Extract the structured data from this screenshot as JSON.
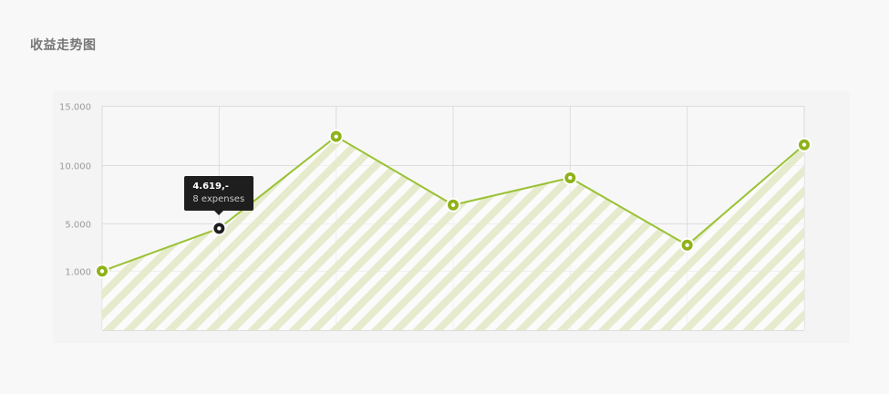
{
  "page": {
    "title": "收益走势图"
  },
  "colors": {
    "line": "#9ac234",
    "point": "#8fb21a",
    "point_active": "#1e1e1e",
    "grid": "#dddddd",
    "hatch": "#e8ecd3"
  },
  "tooltip": {
    "value_label": "4.619,-",
    "sub_label": "8 expenses",
    "point_index": 1
  },
  "chart_data": {
    "type": "area",
    "x": [
      0,
      1,
      2,
      3,
      4,
      5,
      6
    ],
    "y_ticks": [
      1000,
      5000,
      10000,
      15000
    ],
    "y_tick_labels": [
      "1.000",
      "5.000",
      "10.000",
      "15.000"
    ],
    "series": [
      {
        "values": [
          1000,
          4619,
          12400,
          6600,
          8900,
          3200,
          11700
        ]
      }
    ],
    "title": "",
    "xlabel": "",
    "ylabel": "",
    "ylim": [
      -4000,
      15000
    ],
    "grid": true,
    "legend": "none"
  }
}
